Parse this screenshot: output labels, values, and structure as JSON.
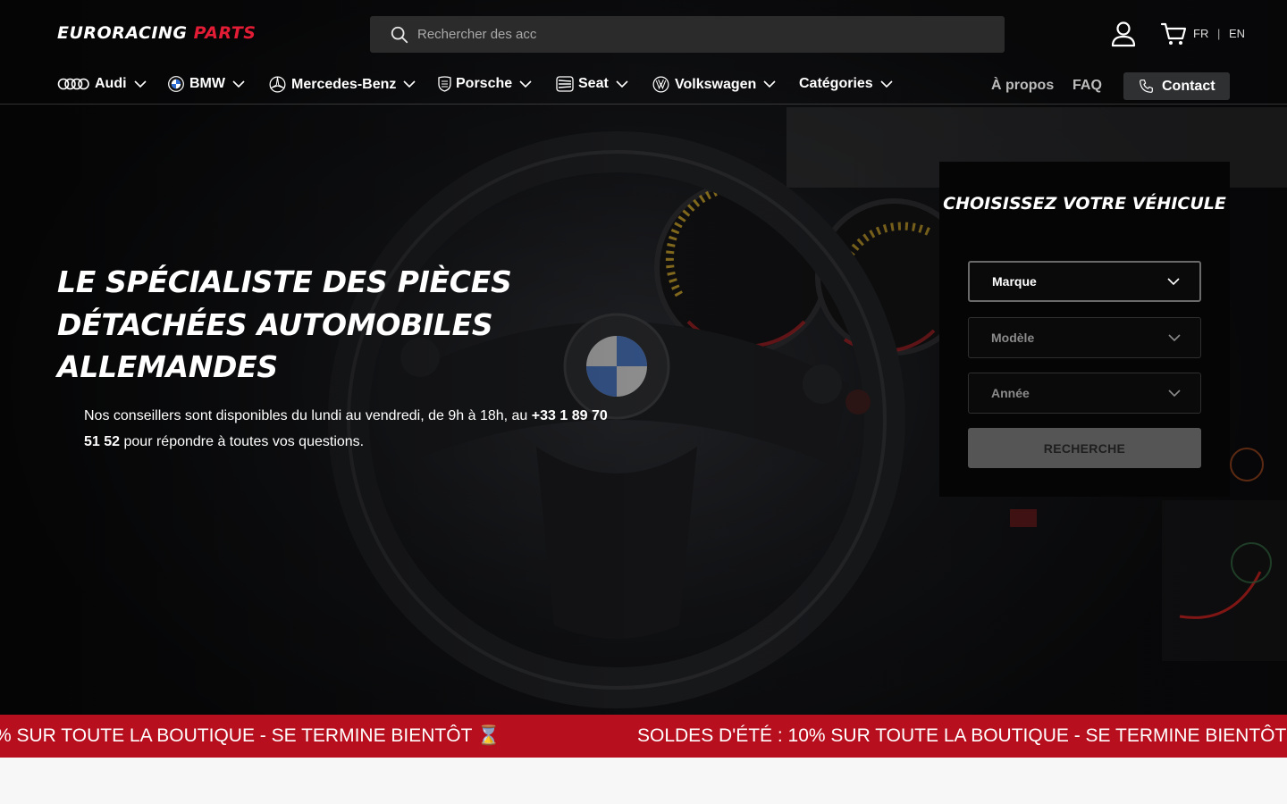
{
  "header": {
    "logo_part1": "EURORACING",
    "logo_part2": "PARTS",
    "search_placeholder": "Rechercher des acc",
    "languages": [
      "FR",
      "EN"
    ]
  },
  "nav": {
    "brands": [
      {
        "label": "Audi",
        "icon": "audi-rings-icon"
      },
      {
        "label": "BMW",
        "icon": "bmw-logo-icon"
      },
      {
        "label": "Mercedes-Benz",
        "icon": "mercedes-star-icon"
      },
      {
        "label": "Porsche",
        "icon": "porsche-crest-icon"
      },
      {
        "label": "Seat",
        "icon": "seat-logo-icon"
      },
      {
        "label": "Volkswagen",
        "icon": "vw-logo-icon"
      },
      {
        "label": "Catégories",
        "icon": ""
      }
    ],
    "links": [
      "À propos",
      "FAQ"
    ],
    "contact": "Contact"
  },
  "hero": {
    "title": "LE SPÉCIALISTE DES PIÈCES DÉTACHÉES AUTOMOBILES ALLEMANDES",
    "subtitle_pre": "Nos conseillers sont disponibles du lundi au vendredi, de 9h à 18h, au ",
    "phone": "+33 1 89 70 51 52",
    "subtitle_post": " pour répondre à toutes vos questions."
  },
  "vehicle_selector": {
    "title": "CHOISISSEZ VOTRE VÉHICULE",
    "fields": [
      "Marque",
      "Modèle",
      "Année"
    ],
    "button": "RECHERCHE"
  },
  "promo": {
    "fragment": "% SUR TOUTE LA BOUTIQUE - SE TERMINE BIENTÔT ⌛",
    "text": "SOLDES D'ÉTÉ : 10% SUR TOUTE LA BOUTIQUE - SE TERMINE BIENTÔT"
  },
  "colors": {
    "accent_red": "#e21c34",
    "promo_bg": "#b70f1e",
    "panel_bg": "#050505"
  }
}
